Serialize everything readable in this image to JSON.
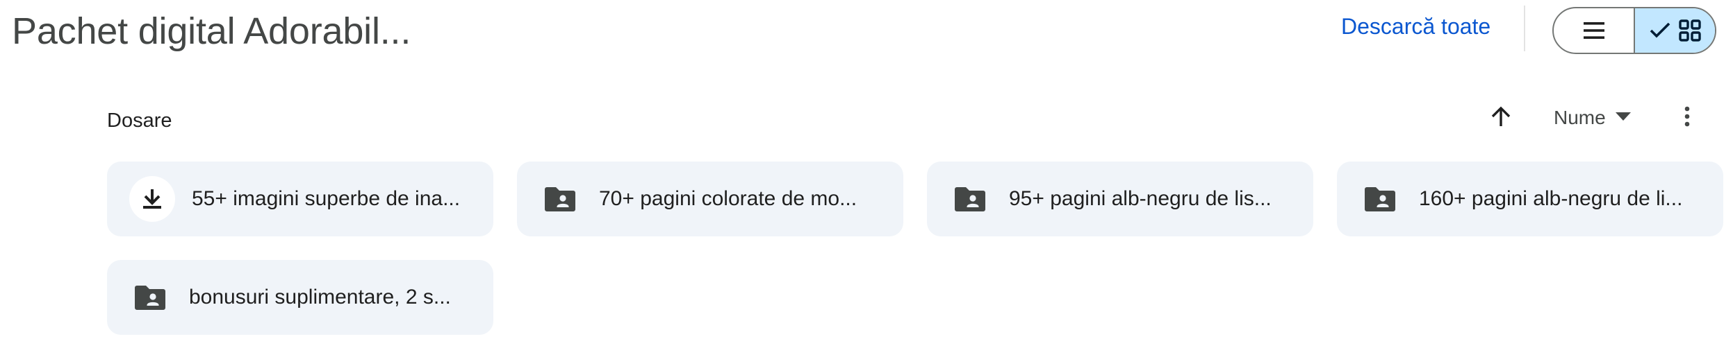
{
  "header": {
    "title": "Pachet digital Adorabil...",
    "download_all_label": "Descarcă toate"
  },
  "view_toggle": {
    "list_icon": "list-icon",
    "grid_icon": "grid-icon",
    "check_icon": "check-icon",
    "selected": "grid"
  },
  "section": {
    "label": "Dosare",
    "sort_direction_icon": "arrow-up-icon",
    "sort_field_label": "Nume",
    "sort_dropdown_icon": "caret-down-icon",
    "more_icon": "more-vert-icon"
  },
  "folders": [
    {
      "name": "55+ imagini superbe de ina...",
      "icon": "download-icon"
    },
    {
      "name": "70+ pagini colorate de mo...",
      "icon": "shared-folder-icon"
    },
    {
      "name": "95+ pagini alb-negru de lis...",
      "icon": "shared-folder-icon"
    },
    {
      "name": "160+ pagini alb-negru de li...",
      "icon": "shared-folder-icon"
    },
    {
      "name": "bonusuri suplimentare, 2 s...",
      "icon": "shared-folder-icon"
    }
  ],
  "colors": {
    "accent": "#0b57d0",
    "card_bg": "#f0f4f9",
    "toggle_selected_bg": "#c2e7ff",
    "icon_dark": "#444746"
  }
}
